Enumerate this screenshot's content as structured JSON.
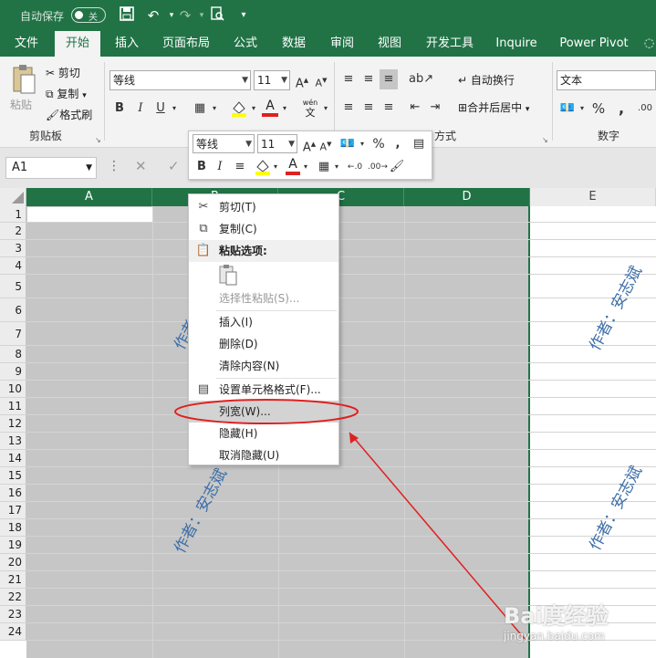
{
  "titlebar": {
    "autosave_label": "自动保存",
    "toggle_state": "关"
  },
  "tabs": [
    "文件",
    "开始",
    "插入",
    "页面布局",
    "公式",
    "数据",
    "审阅",
    "视图",
    "开发工具",
    "Inquire",
    "Power Pivot"
  ],
  "active_tab": "开始",
  "ribbon": {
    "paste": "粘贴",
    "cut": "剪切",
    "copy": "复制",
    "format_painter": "格式刷",
    "clipboard_group": "剪贴板",
    "font_name": "等线",
    "font_size": "11",
    "wrap_text": "自动换行",
    "merge_center": "合并后居中",
    "alignment_group": "方式",
    "number_format": "文本",
    "number_group": "数字",
    "wen_label": "wén",
    "wen_char": "文"
  },
  "name_box": "A1",
  "columns": [
    "A",
    "B",
    "C",
    "D",
    "E"
  ],
  "rows": [
    "1",
    "2",
    "3",
    "4",
    "5",
    "6",
    "7",
    "8",
    "9",
    "10",
    "11",
    "12",
    "13",
    "14",
    "15",
    "16",
    "17",
    "18",
    "19",
    "20",
    "21",
    "22",
    "23",
    "24"
  ],
  "mini_toolbar": {
    "font_name": "等线",
    "font_size": "11"
  },
  "context_menu": {
    "cut": "剪切(T)",
    "copy": "复制(C)",
    "paste_options": "粘贴选项:",
    "paste_special": "选择性粘贴(S)...",
    "insert": "插入(I)",
    "delete": "删除(D)",
    "clear_contents": "清除内容(N)",
    "format_cells": "设置单元格格式(F)...",
    "column_width": "列宽(W)...",
    "hide": "隐藏(H)",
    "unhide": "取消隐藏(U)"
  },
  "watermark": "作者：安志斌",
  "brand_watermark": {
    "logo": "Bai度经验",
    "url": "jingyan.baidu.com"
  },
  "colors": {
    "excel_green": "#217346",
    "selection_gray": "#c6c6c6",
    "annotation_red": "#e02020",
    "watermark_blue": "#3c6ea8"
  }
}
